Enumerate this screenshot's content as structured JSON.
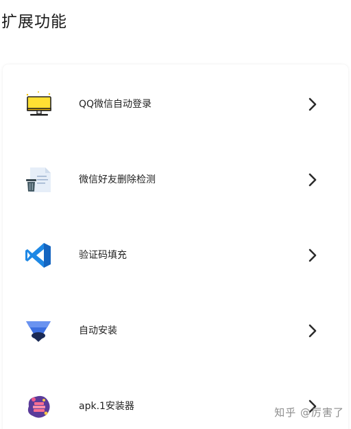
{
  "page": {
    "title": "扩展功能"
  },
  "menu": {
    "items": [
      {
        "label": "QQ微信自动登录",
        "icon": "monitor-icon"
      },
      {
        "label": "微信好友删除检测",
        "icon": "document-trash-icon"
      },
      {
        "label": "验证码填充",
        "icon": "vscode-icon"
      },
      {
        "label": "自动安装",
        "icon": "triangle-installer-icon"
      },
      {
        "label": "apk.1安装器",
        "icon": "apk-installer-icon"
      }
    ]
  },
  "watermark": {
    "text": "知乎 @厉害了"
  },
  "colors": {
    "chevron": "#2b2b2b",
    "label": "#222222",
    "vscode_blue": "#1e88e5",
    "triangle_blue": "#3d6fe0"
  }
}
